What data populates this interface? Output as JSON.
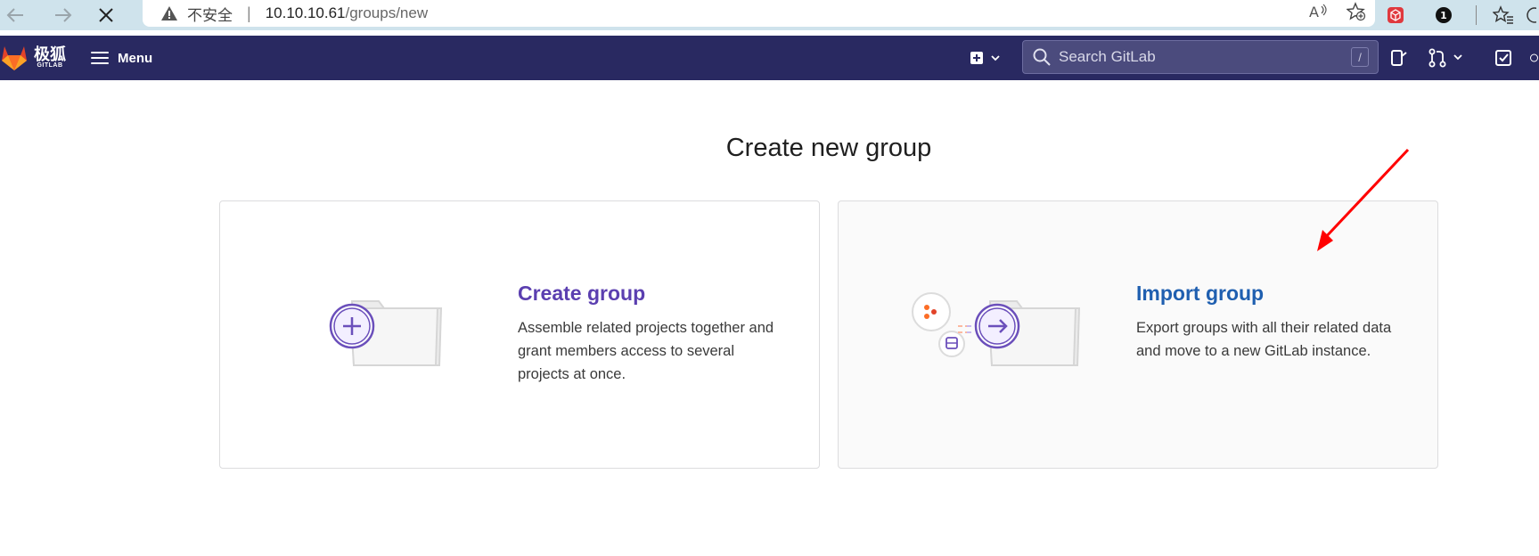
{
  "browser": {
    "insecure_label": "不安全",
    "separator": "|",
    "url_host": "10.10.10.61",
    "url_path": "/groups/new",
    "ext_badge_count": "1"
  },
  "header": {
    "logo_text": "极狐",
    "logo_subtext": "GITLAB",
    "menu_label": "Menu",
    "search_placeholder": "Search GitLab",
    "search_shortcut": "/"
  },
  "page": {
    "title": "Create new group"
  },
  "cards": [
    {
      "title": "Create group",
      "description": "Assemble related projects together and grant members access to several projects at once."
    },
    {
      "title": "Import group",
      "description": "Export groups with all their related data and move to a new GitLab instance."
    }
  ],
  "colors": {
    "header_bg": "#292961",
    "create_title": "#5b3fb0",
    "import_title": "#1f5fb0",
    "annotation_arrow": "#ff0000"
  }
}
